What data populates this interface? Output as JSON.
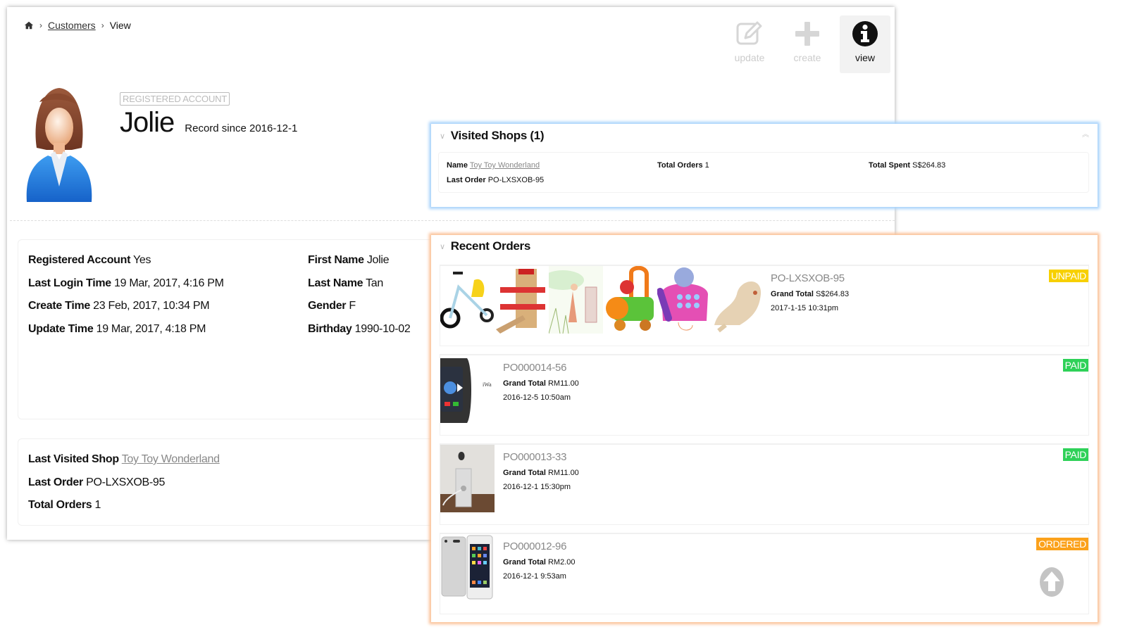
{
  "breadcrumb": {
    "home_icon": "home-icon",
    "items": [
      "Customers",
      "View"
    ]
  },
  "toolbar": {
    "buttons": [
      {
        "label": "update",
        "icon": "edit-icon",
        "active": false
      },
      {
        "label": "create",
        "icon": "plus-icon",
        "active": false
      },
      {
        "label": "view",
        "icon": "info-icon",
        "active": true
      }
    ]
  },
  "profile": {
    "badge": "REGISTERED ACCOUNT",
    "name": "Jolie",
    "since": "Record since 2016-12-1",
    "avatar_icon": "female-user-avatar-icon"
  },
  "details": {
    "left": [
      {
        "label": "Registered Account",
        "value": "Yes"
      },
      {
        "label": "Last Login Time",
        "value": "19 Mar, 2017, 4:16 PM"
      },
      {
        "label": "Create Time",
        "value": "23 Feb, 2017, 10:34 PM"
      },
      {
        "label": "Update Time",
        "value": "19 Mar, 2017, 4:18 PM"
      }
    ],
    "right": [
      {
        "label": "First Name",
        "value": "Jolie"
      },
      {
        "label": "Last Name",
        "value": "Tan"
      },
      {
        "label": "Gender",
        "value": "F"
      },
      {
        "label": "Birthday",
        "value": "1990-10-02"
      }
    ]
  },
  "summary": {
    "last_visited_shop_label": "Last Visited Shop",
    "last_visited_shop": "Toy Toy Wonderland",
    "last_order_label": "Last Order",
    "last_order": "PO-LXSXOB-95",
    "total_orders_label": "Total Orders",
    "total_orders": "1"
  },
  "visited_shops": {
    "title": "Visited Shops (1)",
    "collapse_icon": "double-chevron-up-icon",
    "shops": [
      {
        "name_label": "Name",
        "name": "Toy Toy Wonderland",
        "total_orders_label": "Total Orders",
        "total_orders": "1",
        "total_spent_label": "Total Spent",
        "total_spent": "S$264.83",
        "last_order_label": "Last Order",
        "last_order": "PO-LXSXOB-95"
      }
    ]
  },
  "recent_orders": {
    "title": "Recent Orders",
    "grand_total_label": "Grand Total",
    "orders": [
      {
        "order_no": "PO-LXSXOB-95",
        "grand_total": "S$264.83",
        "date": "2017-1-15 10:31pm",
        "status": "UNPAID",
        "status_color": "#f7d000",
        "thumbnails": [
          "tricycle",
          "wooden-parking-garage",
          "watercolor-illustration",
          "ride-on-train",
          "pink-toy-phone",
          "plush-seal"
        ]
      },
      {
        "order_no": "PO000014-56",
        "grand_total": "RM11.00",
        "date": "2016-12-5 10:50am",
        "status": "PAID",
        "status_color": "#2ed158",
        "thumbnails": [
          "smartwatch"
        ]
      },
      {
        "order_no": "PO000013-33",
        "grand_total": "RM11.00",
        "date": "2016-12-1 15:30pm",
        "status": "PAID",
        "status_color": "#2ed158",
        "thumbnails": [
          "imac-back"
        ]
      },
      {
        "order_no": "PO000012-96",
        "grand_total": "RM2.00",
        "date": "2016-12-1 9:53am",
        "status": "ORDERED",
        "status_color": "#fba11b",
        "thumbnails": [
          "ipod-touch"
        ]
      }
    ],
    "scroll_top_icon": "arrow-up-circle-icon"
  }
}
